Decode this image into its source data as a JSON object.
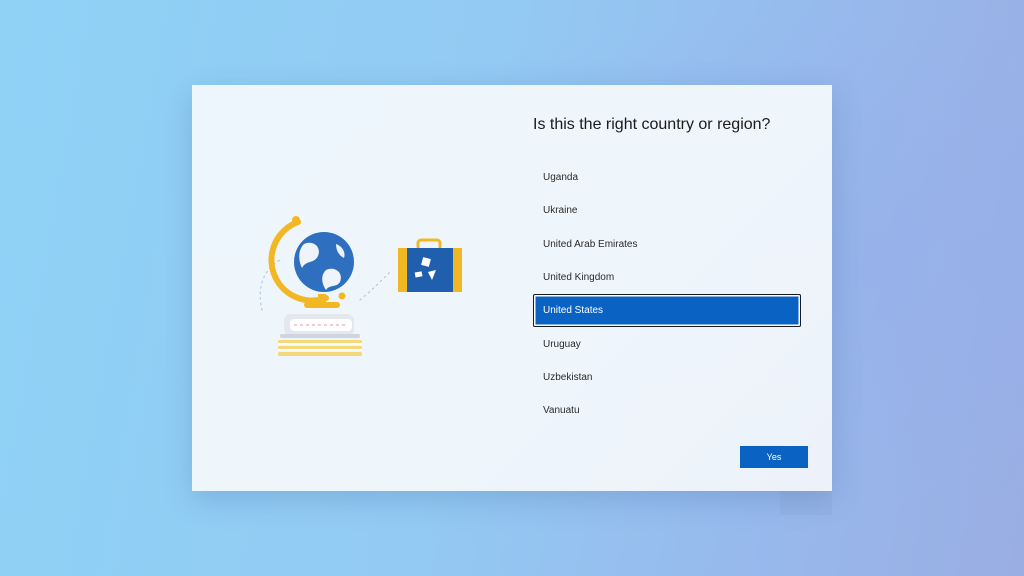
{
  "dialog": {
    "title": "Is this the right country or region?",
    "countries": [
      "Uganda",
      "Ukraine",
      "United Arab Emirates",
      "United Kingdom",
      "United States",
      "Uruguay",
      "Uzbekistan",
      "Vanuatu"
    ],
    "selected": "United States",
    "yes_label": "Yes"
  },
  "illustration": {
    "icons": [
      "globe-icon",
      "books-icon",
      "suitcase-icon"
    ]
  },
  "colors": {
    "accent": "#0a63c3",
    "globe_yellow": "#f2b824",
    "globe_blue": "#2f6fbf",
    "suitcase_blue": "#1f5fae"
  }
}
